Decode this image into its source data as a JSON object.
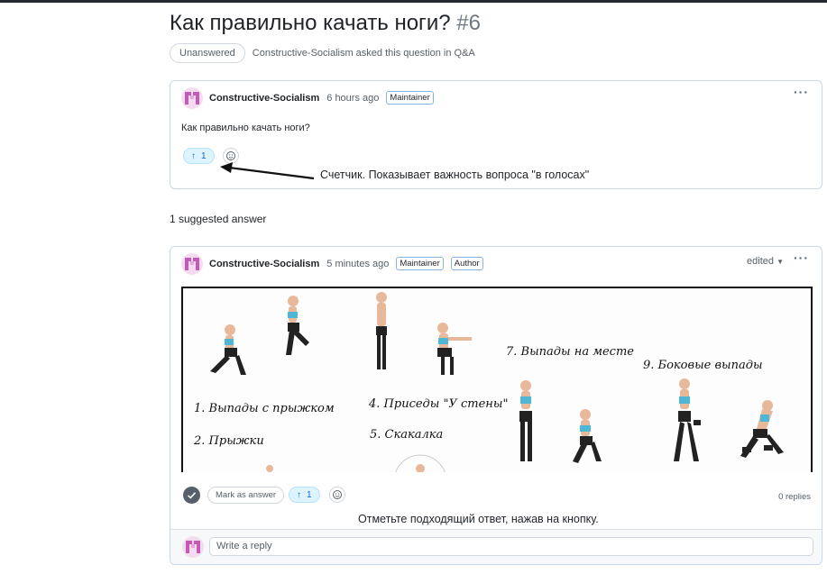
{
  "question": {
    "title": "Как правильно качать ноги?",
    "number": "#6",
    "status": "Unanswered",
    "asked_line": "Constructive-Socialism asked this question in Q&A"
  },
  "post": {
    "author": "Constructive-Socialism",
    "time": "6 hours ago",
    "badge": "Maintainer",
    "text": "Как правильно качать ноги?",
    "votes": "1"
  },
  "annotations": {
    "counter": "Счетчик. Показывает важность вопроса \"в голосах\"",
    "mark": "Отметьте подходящий ответ, нажав на кнопку."
  },
  "answers": {
    "count_label": "1 suggested answer"
  },
  "answer": {
    "author": "Constructive-Socialism",
    "time": "5 minutes ago",
    "badges": [
      "Maintainer",
      "Author"
    ],
    "edited": "edited",
    "image_labels": [
      "1. Выпады с прыжком",
      "2. Прыжки",
      "4. Приседы \"У стены\"",
      "5. Скакалка",
      "7. Выпады на месте",
      "9. Боковые выпады"
    ],
    "mark_label": "Mark as answer",
    "votes": "1",
    "replies": "0 replies",
    "reply_placeholder": "Write a reply"
  },
  "icons": {
    "more": "kebab-horizontal-icon",
    "upvote": "arrow-up-icon",
    "emoji": "smiley-icon",
    "check": "check-circle-icon",
    "caret": "triangle-down-icon"
  },
  "colors": {
    "accent": "#0969da",
    "vote_bg": "#ddf4ff",
    "card_border": "#c8d8ea",
    "avatar": "#c45ab3"
  }
}
